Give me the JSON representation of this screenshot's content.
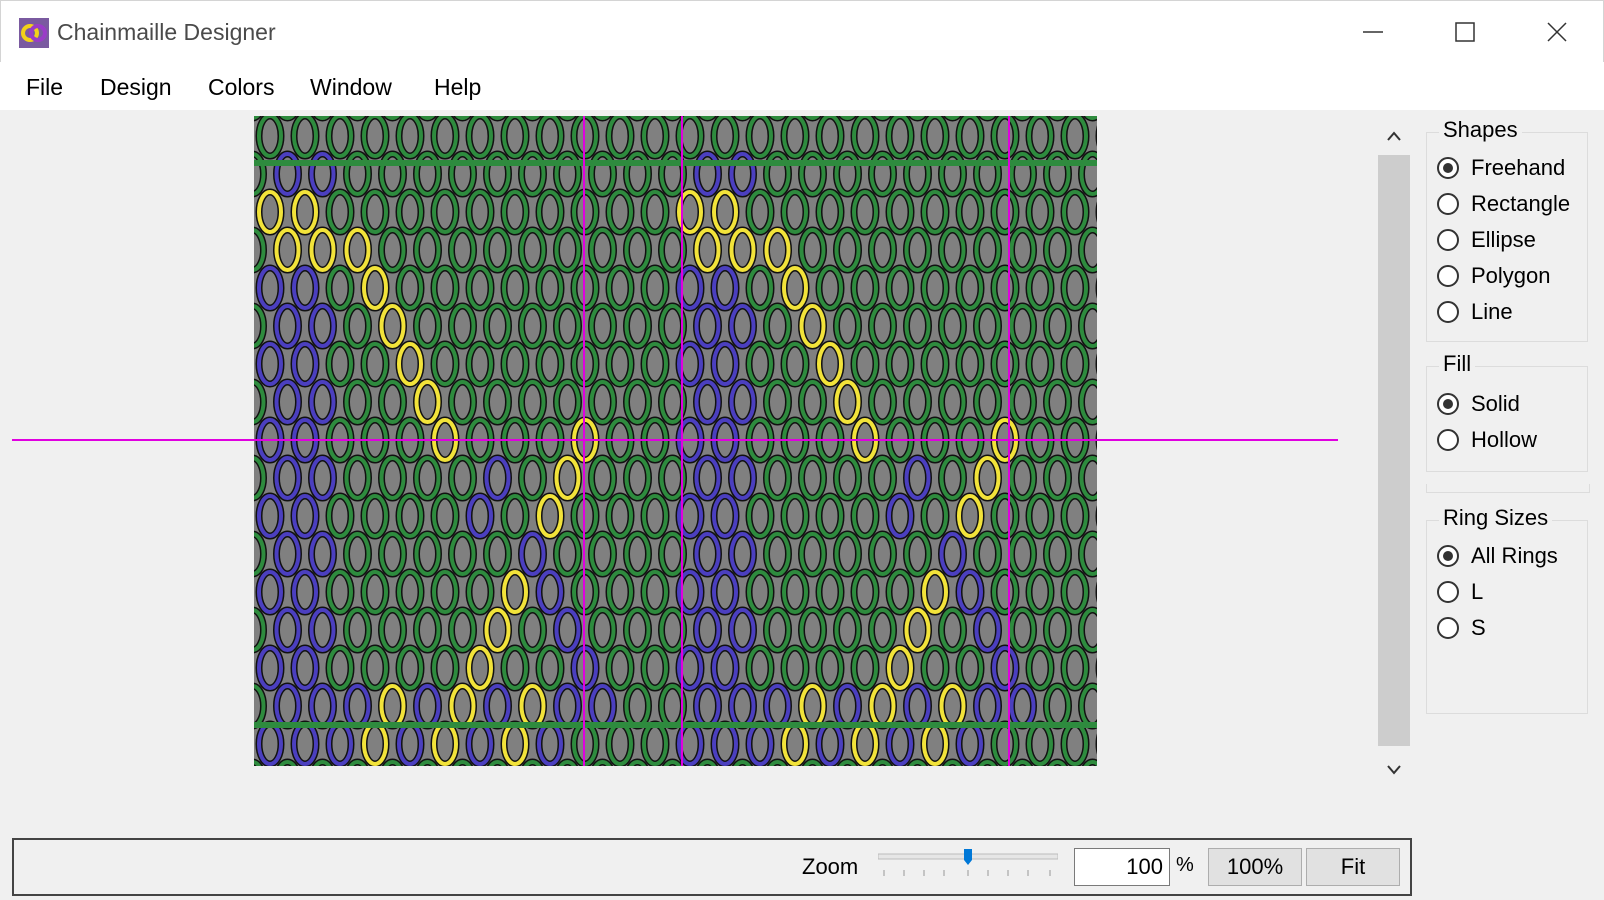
{
  "window": {
    "title": "Chainmaille Designer",
    "controls": [
      "minimize-icon",
      "maximize-icon",
      "close-icon"
    ]
  },
  "menu": {
    "items": [
      "File",
      "Design",
      "Colors",
      "Window",
      "Help"
    ]
  },
  "canvas": {
    "background": "#808080",
    "ring_colors": {
      "base": "#2e8b3e",
      "blue": "#4b3fbf",
      "yellow": "#f2e33a",
      "guide": "#e000e0"
    }
  },
  "panel": {
    "shapes": {
      "title": "Shapes",
      "options": [
        "Freehand",
        "Rectangle",
        "Ellipse",
        "Polygon",
        "Line"
      ],
      "selected": "Freehand"
    },
    "fill": {
      "title": "Fill",
      "options": [
        "Solid",
        "Hollow"
      ],
      "selected": "Solid"
    },
    "ring_sizes": {
      "title": "Ring Sizes",
      "options": [
        "All Rings",
        "L",
        "S"
      ],
      "selected": "All Rings"
    }
  },
  "status": {
    "zoom_label": "Zoom",
    "zoom_value": "100",
    "zoom_unit": "%",
    "btn_100": "100%",
    "btn_fit": "Fit"
  }
}
